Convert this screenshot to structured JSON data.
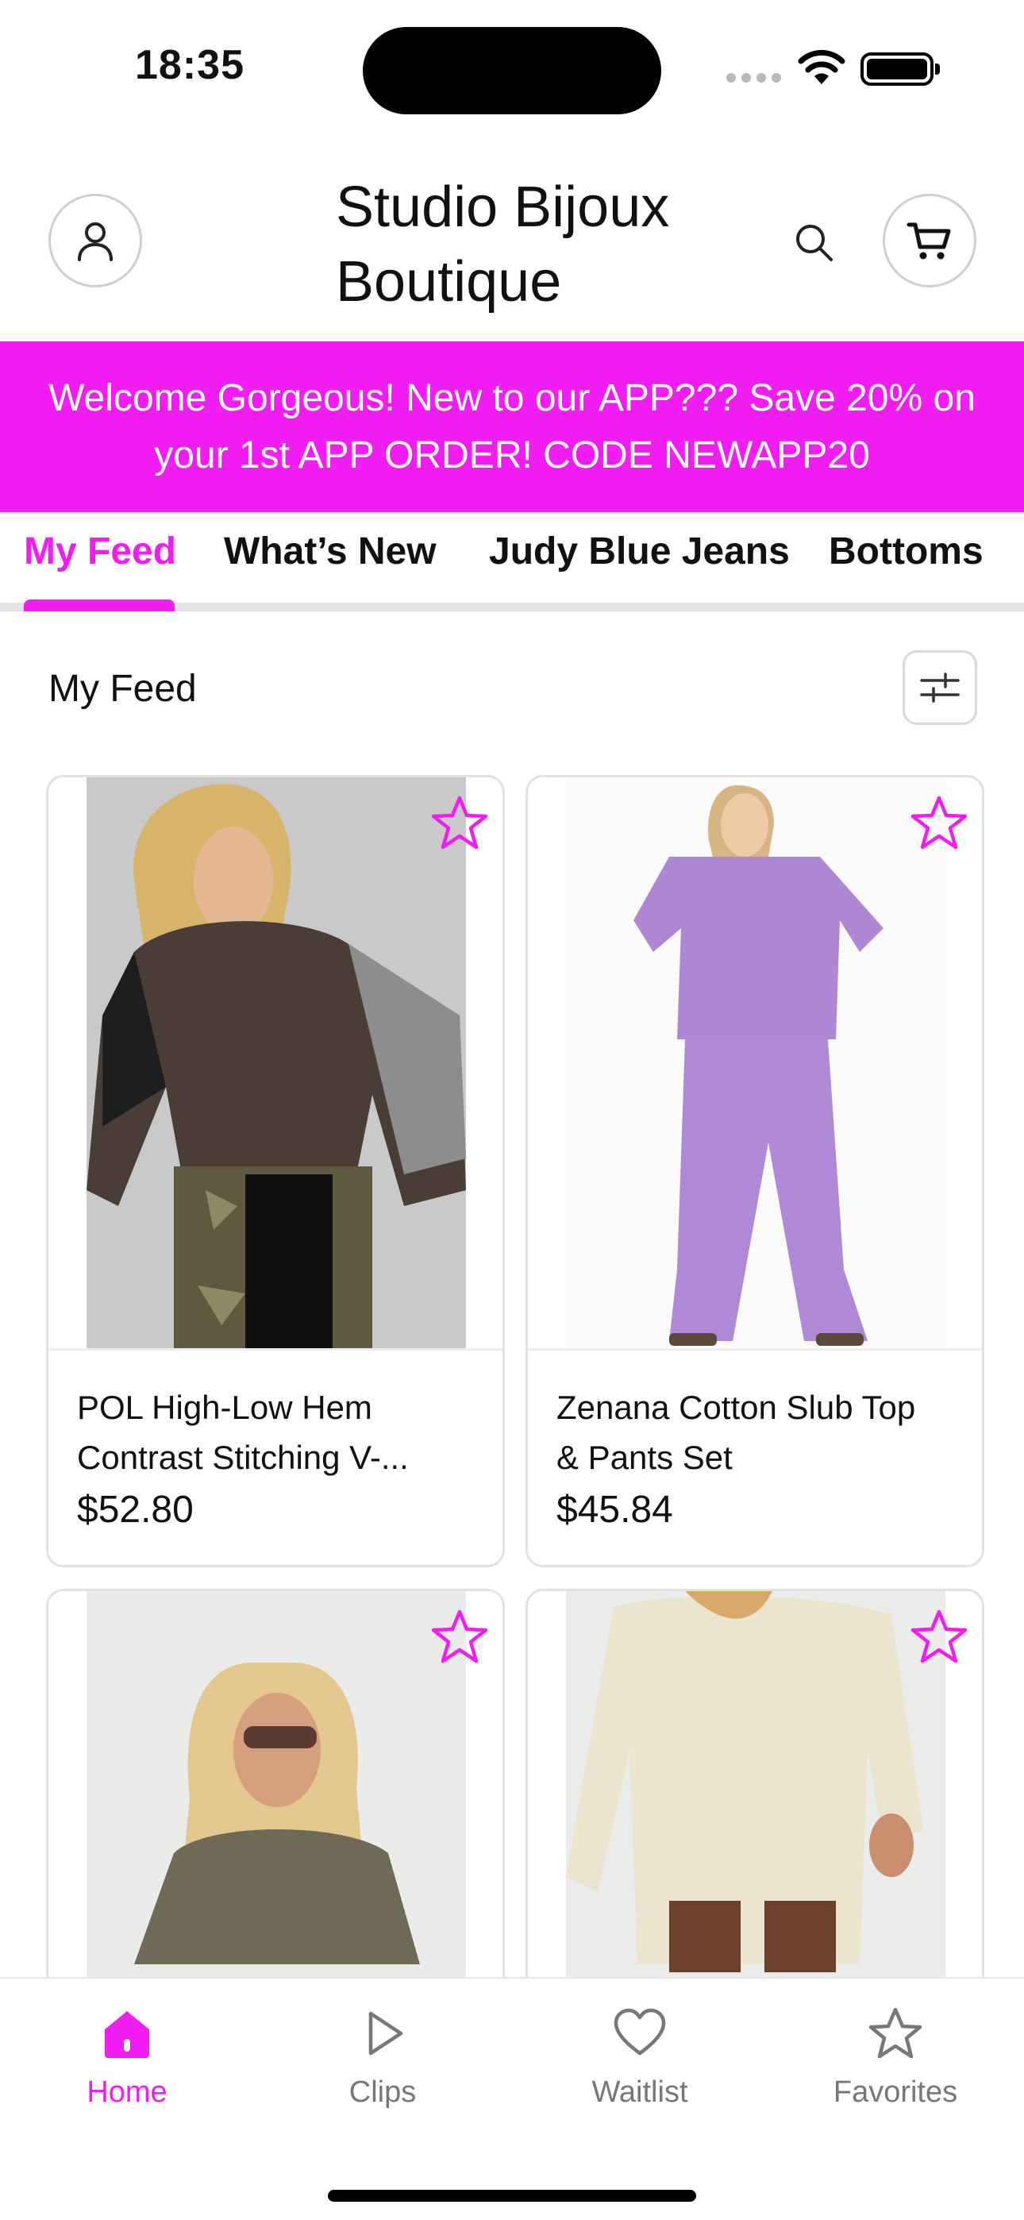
{
  "status_bar": {
    "time": "18:35",
    "icons": [
      "signal-icon",
      "wifi-icon",
      "battery-icon"
    ]
  },
  "header": {
    "title": "Studio Bijoux Boutique",
    "icons": [
      "account-icon",
      "search-icon",
      "cart-icon"
    ]
  },
  "promo": {
    "text": "Welcome Gorgeous! New to our APP??? Save 20% on your 1st APP ORDER! CODE NEWAPP20"
  },
  "tabs": [
    {
      "label": "My Feed",
      "active": true
    },
    {
      "label": "What’s New",
      "active": false
    },
    {
      "label": "Judy Blue Jeans",
      "active": false
    },
    {
      "label": "Bottoms",
      "active": false
    }
  ],
  "feed": {
    "heading": "My Feed",
    "filter_icon": "sliders-icon",
    "products": [
      {
        "name": "POL High-Low Hem Contrast Stitching V-...",
        "price": "$52.80"
      },
      {
        "name": "Zenana Cotton Slub Top & Pants Set",
        "price": "$45.84"
      },
      {
        "name": "",
        "price": ""
      },
      {
        "name": "",
        "price": ""
      }
    ]
  },
  "bottom_nav": [
    {
      "label": "Home",
      "icon": "home-icon",
      "active": true
    },
    {
      "label": "Clips",
      "icon": "play-icon",
      "active": false
    },
    {
      "label": "Waitlist",
      "icon": "heart-icon",
      "active": false
    },
    {
      "label": "Favorites",
      "icon": "star-icon",
      "active": false
    }
  ],
  "colors": {
    "accent": "#f21df2",
    "text": "#111111",
    "muted": "#777777"
  }
}
